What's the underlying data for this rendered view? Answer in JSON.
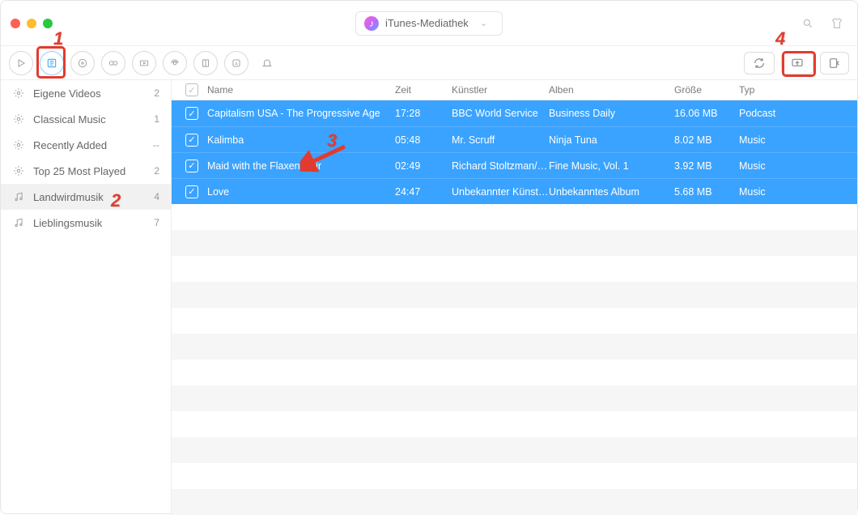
{
  "header": {
    "title": "iTunes-Mediathek"
  },
  "toolbar": {
    "icons": [
      {
        "name": "play-icon"
      },
      {
        "name": "library-icon",
        "active": true
      },
      {
        "name": "disc-icon"
      },
      {
        "name": "gamepad-icon"
      },
      {
        "name": "video-icon"
      },
      {
        "name": "podcast-icon"
      },
      {
        "name": "audiobook-icon"
      },
      {
        "name": "app-icon"
      },
      {
        "name": "bell-icon"
      }
    ],
    "right": [
      {
        "name": "refresh-button"
      },
      {
        "name": "send-to-device-button",
        "highlight": true
      },
      {
        "name": "import-button"
      }
    ]
  },
  "sidebar": {
    "items": [
      {
        "icon": "gear-icon",
        "label": "Eigene Videos",
        "count": "2"
      },
      {
        "icon": "gear-icon",
        "label": "Classical Music",
        "count": "1"
      },
      {
        "icon": "gear-icon",
        "label": "Recently Added",
        "count": "--"
      },
      {
        "icon": "gear-icon",
        "label": "Top 25 Most Played",
        "count": "2"
      },
      {
        "icon": "playlist-icon",
        "label": "Landwirdmusik",
        "count": "4",
        "selected": true
      },
      {
        "icon": "playlist-icon",
        "label": "Lieblingsmusik",
        "count": "7"
      }
    ]
  },
  "table": {
    "headers": {
      "name": "Name",
      "time": "Zeit",
      "artist": "Künstler",
      "album": "Alben",
      "size": "Größe",
      "type": "Typ"
    },
    "rows": [
      {
        "name": "Capitalism USA - The Progressive Age",
        "time": "17:28",
        "artist": "BBC World Service",
        "album": "Business Daily",
        "size": "16.06 MB",
        "type": "Podcast"
      },
      {
        "name": "Kalimba",
        "time": "05:48",
        "artist": "Mr. Scruff",
        "album": "Ninja Tuna",
        "size": "8.02 MB",
        "type": "Music"
      },
      {
        "name": "Maid with the Flaxen Hair",
        "time": "02:49",
        "artist": "Richard Stoltzman/Slo...",
        "album": "Fine Music, Vol. 1",
        "size": "3.92 MB",
        "type": "Music"
      },
      {
        "name": "Love",
        "time": "24:47",
        "artist": "Unbekannter Künstler",
        "album": "Unbekanntes Album",
        "size": "5.68 MB",
        "type": "Music"
      }
    ]
  },
  "annotations": {
    "n1": "1",
    "n2": "2",
    "n3": "3",
    "n4": "4"
  }
}
